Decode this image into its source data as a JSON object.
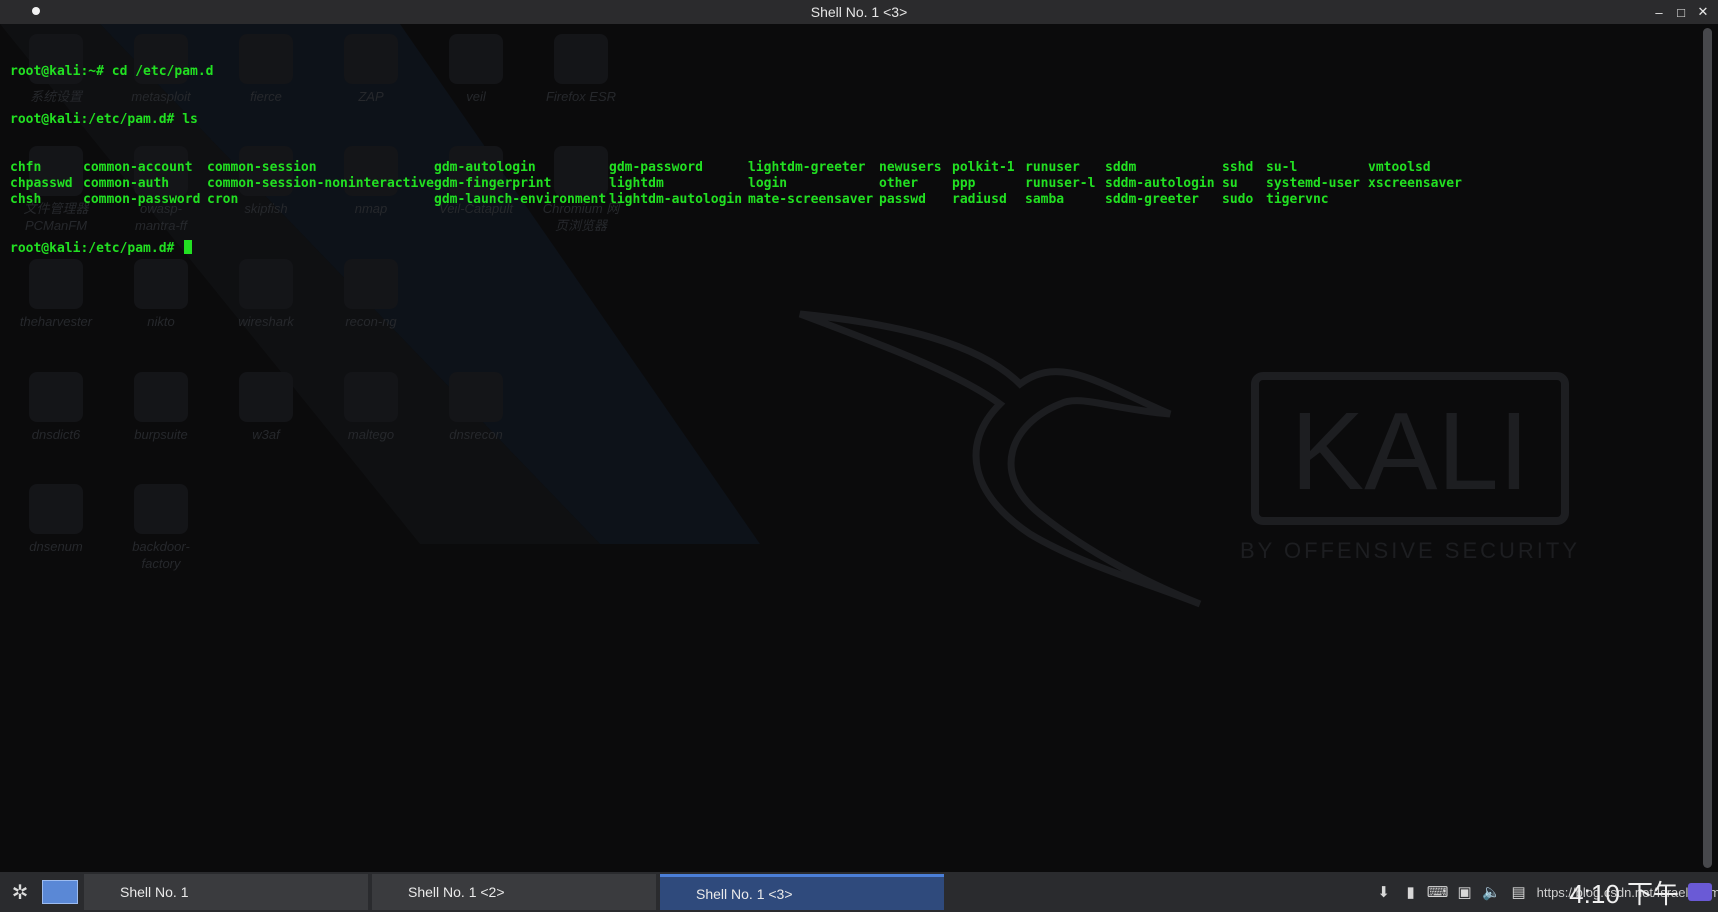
{
  "window": {
    "title": "Shell No. 1 <3>",
    "controls": {
      "minimize": "–",
      "maximize": "□",
      "close": "✕"
    }
  },
  "terminal": {
    "prompt_home": "root@kali:~#",
    "cmd1": " cd /etc/pam.d",
    "prompt_pamd": "root@kali:/etc/pam.d#",
    "cmd2": " ls",
    "ls_columns": [
      [
        "chfn",
        "chpasswd",
        "chsh"
      ],
      [
        "common-account",
        "common-auth",
        "common-password"
      ],
      [
        "common-session",
        "common-session-noninteractive",
        "cron"
      ],
      [
        "gdm-autologin",
        "gdm-fingerprint",
        "gdm-launch-environment"
      ],
      [
        "gdm-password",
        "lightdm",
        "lightdm-autologin"
      ],
      [
        "lightdm-greeter",
        "login",
        "mate-screensaver"
      ],
      [
        "newusers",
        "other",
        "passwd"
      ],
      [
        "polkit-1",
        "ppp",
        "radiusd"
      ],
      [
        "runuser",
        "runuser-l",
        "samba"
      ],
      [
        "sddm",
        "sddm-autologin",
        "sddm-greeter"
      ],
      [
        "sshd",
        "su",
        "sudo"
      ],
      [
        "su-l",
        "systemd-user",
        "tigervnc"
      ],
      [
        "vmtoolsd",
        "xscreensaver",
        ""
      ]
    ]
  },
  "desktop_icons": [
    {
      "label": "系统设置"
    },
    {
      "label": "metasploit"
    },
    {
      "label": "fierce"
    },
    {
      "label": "ZAP"
    },
    {
      "label": "veil"
    },
    {
      "label": "Firefox ESR"
    },
    {
      "label": "文件管理器\nPCManFM"
    },
    {
      "label": "owasp-\nmantra-ff"
    },
    {
      "label": "skipfish"
    },
    {
      "label": "nmap"
    },
    {
      "label": "Veil-Catapult"
    },
    {
      "label": "Chromium 网\n页浏览器"
    },
    {
      "label": "theharvester"
    },
    {
      "label": "nikto"
    },
    {
      "label": "wireshark"
    },
    {
      "label": "recon-ng"
    },
    {
      "label": "dnsdict6"
    },
    {
      "label": "burpsuite"
    },
    {
      "label": "w3af"
    },
    {
      "label": "maltego"
    },
    {
      "label": "dnsrecon"
    },
    {
      "label": "dnsenum"
    },
    {
      "label": "backdoor-\nfactory"
    }
  ],
  "wallpaper": {
    "logo_text": "KALI",
    "tagline": "BY OFFENSIVE SECURITY"
  },
  "taskbar": {
    "tasks": [
      {
        "label": "Shell No. 1"
      },
      {
        "label": "Shell No. 1 <2>"
      },
      {
        "label": "Shell No. 1 <3>"
      }
    ],
    "url_text": "https://blog.csdn.net/Israelxuem",
    "clock": "4:10 下午"
  },
  "colors": {
    "terminal_fg": "#22e022",
    "taskbar_bg": "#2a2b2e",
    "active_task": "#2f4a7c"
  }
}
